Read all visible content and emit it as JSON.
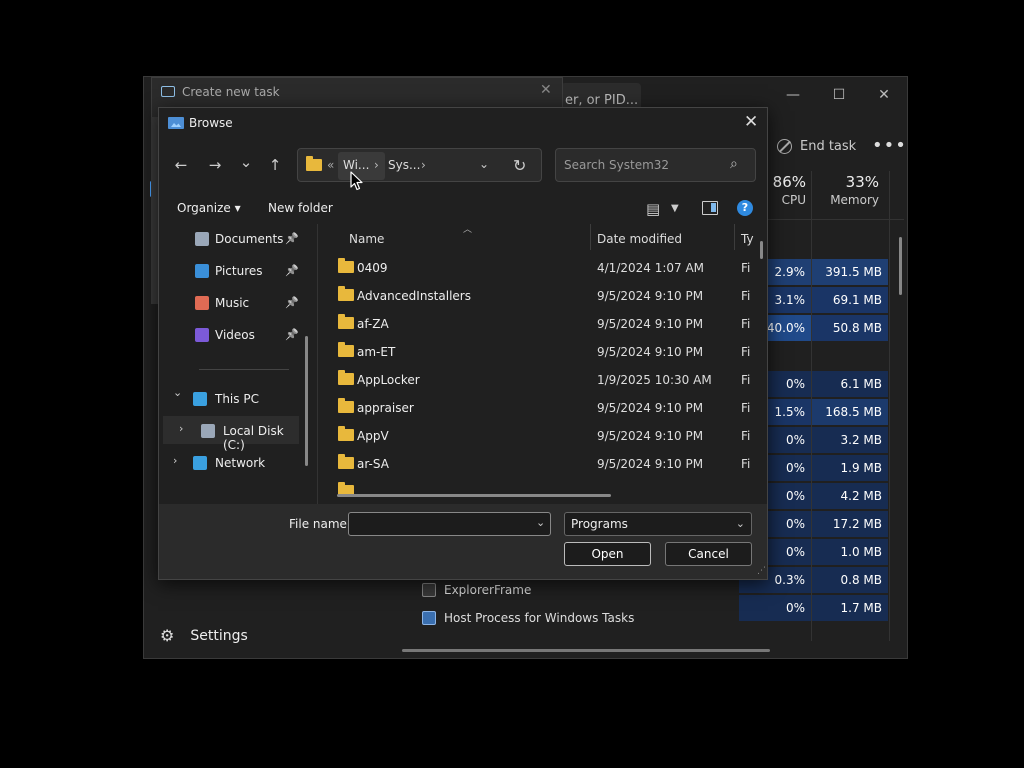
{
  "task_manager": {
    "search_text": "er, or PID...",
    "window_controls": {
      "minimize": "—",
      "maximize": "☐",
      "close": "✕"
    },
    "end_task_label": "End task",
    "more_label": "•••",
    "cpu_header": {
      "pct": "86%",
      "label": "CPU"
    },
    "memory_header": {
      "pct": "33%",
      "label": "Memory"
    },
    "rows": [
      {
        "cpu": "2.9%",
        "mem": "391.5 MB",
        "cpu_hl": "#1f3f73",
        "mem_hl": "#1f3f73"
      },
      {
        "cpu": "3.1%",
        "mem": "69.1 MB",
        "cpu_hl": "#1a3566",
        "mem_hl": "#1a3566"
      },
      {
        "cpu": "40.0%",
        "mem": "50.8 MB",
        "cpu_hl": "#204a8a",
        "mem_hl": "#1a3566"
      },
      {
        "cpu": "",
        "mem": "",
        "cpu_hl": "#202020",
        "mem_hl": "#202020"
      },
      {
        "cpu": "0%",
        "mem": "6.1 MB",
        "cpu_hl": "#172c52",
        "mem_hl": "#172c52"
      },
      {
        "cpu": "1.5%",
        "mem": "168.5 MB",
        "cpu_hl": "#1a3566",
        "mem_hl": "#1c3a6c"
      },
      {
        "cpu": "0%",
        "mem": "3.2 MB",
        "cpu_hl": "#172c52",
        "mem_hl": "#172c52"
      },
      {
        "cpu": "0%",
        "mem": "1.9 MB",
        "cpu_hl": "#172c52",
        "mem_hl": "#172c52"
      },
      {
        "cpu": "0%",
        "mem": "4.2 MB",
        "cpu_hl": "#172c52",
        "mem_hl": "#172c52"
      },
      {
        "cpu": "0%",
        "mem": "17.2 MB",
        "cpu_hl": "#172c52",
        "mem_hl": "#172c52"
      },
      {
        "cpu": "0%",
        "mem": "1.0 MB",
        "cpu_hl": "#172c52",
        "mem_hl": "#172c52"
      },
      {
        "cpu": "0.3%",
        "mem": "0.8 MB",
        "cpu_hl": "#172c52",
        "mem_hl": "#172c52"
      },
      {
        "cpu": "0%",
        "mem": "1.7 MB",
        "cpu_hl": "#172c52",
        "mem_hl": "#172c52"
      }
    ],
    "processes": [
      {
        "name": "ExplorerFrame"
      },
      {
        "name": "Host Process for Windows Tasks"
      }
    ],
    "settings_label": "Settings",
    "settings_icon": "gear-icon"
  },
  "create_task": {
    "title": "Create new task",
    "close": "✕"
  },
  "browse": {
    "title": "Browse",
    "close": "✕",
    "nav": {
      "back": "←",
      "forward": "→",
      "recent": "⌄",
      "up": "↑"
    },
    "address": {
      "overflow": "«",
      "crumbs": [
        "Wi...",
        "Sys..."
      ],
      "separator": "›"
    },
    "search_placeholder": "Search System32",
    "toolbar": {
      "organize": "Organize",
      "organize_caret": "▾",
      "new_folder": "New folder",
      "help": "?"
    },
    "nav_pane": [
      {
        "label": "Documents",
        "icon": "documents-icon",
        "pinned": true,
        "color": "#9aa7b8"
      },
      {
        "label": "Pictures",
        "icon": "pictures-icon",
        "pinned": true,
        "color": "#3a8fd9"
      },
      {
        "label": "Music",
        "icon": "music-icon",
        "pinned": true,
        "color": "#e06b54"
      },
      {
        "label": "Videos",
        "icon": "videos-icon",
        "pinned": true,
        "color": "#7c5ad8"
      },
      {
        "label": "This PC",
        "icon": "this-pc-icon",
        "expanded": true,
        "color": "#3aa0e0"
      },
      {
        "label": "Local Disk (C:)",
        "icon": "local-disk-icon",
        "selected": true,
        "color": "#9aa7b8"
      },
      {
        "label": "Network",
        "icon": "network-icon",
        "color": "#3aa0e0"
      }
    ],
    "columns": {
      "name": "Name",
      "date": "Date modified",
      "type": "Ty"
    },
    "files": [
      {
        "name": "0409",
        "date": "4/1/2024 1:07 AM",
        "type": "Fi"
      },
      {
        "name": "AdvancedInstallers",
        "date": "9/5/2024 9:10 PM",
        "type": "Fi"
      },
      {
        "name": "af-ZA",
        "date": "9/5/2024 9:10 PM",
        "type": "Fi"
      },
      {
        "name": "am-ET",
        "date": "9/5/2024 9:10 PM",
        "type": "Fi"
      },
      {
        "name": "AppLocker",
        "date": "1/9/2025 10:30 AM",
        "type": "Fi"
      },
      {
        "name": "appraiser",
        "date": "9/5/2024 9:10 PM",
        "type": "Fi"
      },
      {
        "name": "AppV",
        "date": "9/5/2024 9:10 PM",
        "type": "Fi"
      },
      {
        "name": "ar-SA",
        "date": "9/5/2024 9:10 PM",
        "type": "Fi"
      }
    ],
    "file_name_label": "File name:",
    "file_name_value": "",
    "file_type_value": "Programs",
    "open_label": "Open",
    "cancel_label": "Cancel"
  }
}
